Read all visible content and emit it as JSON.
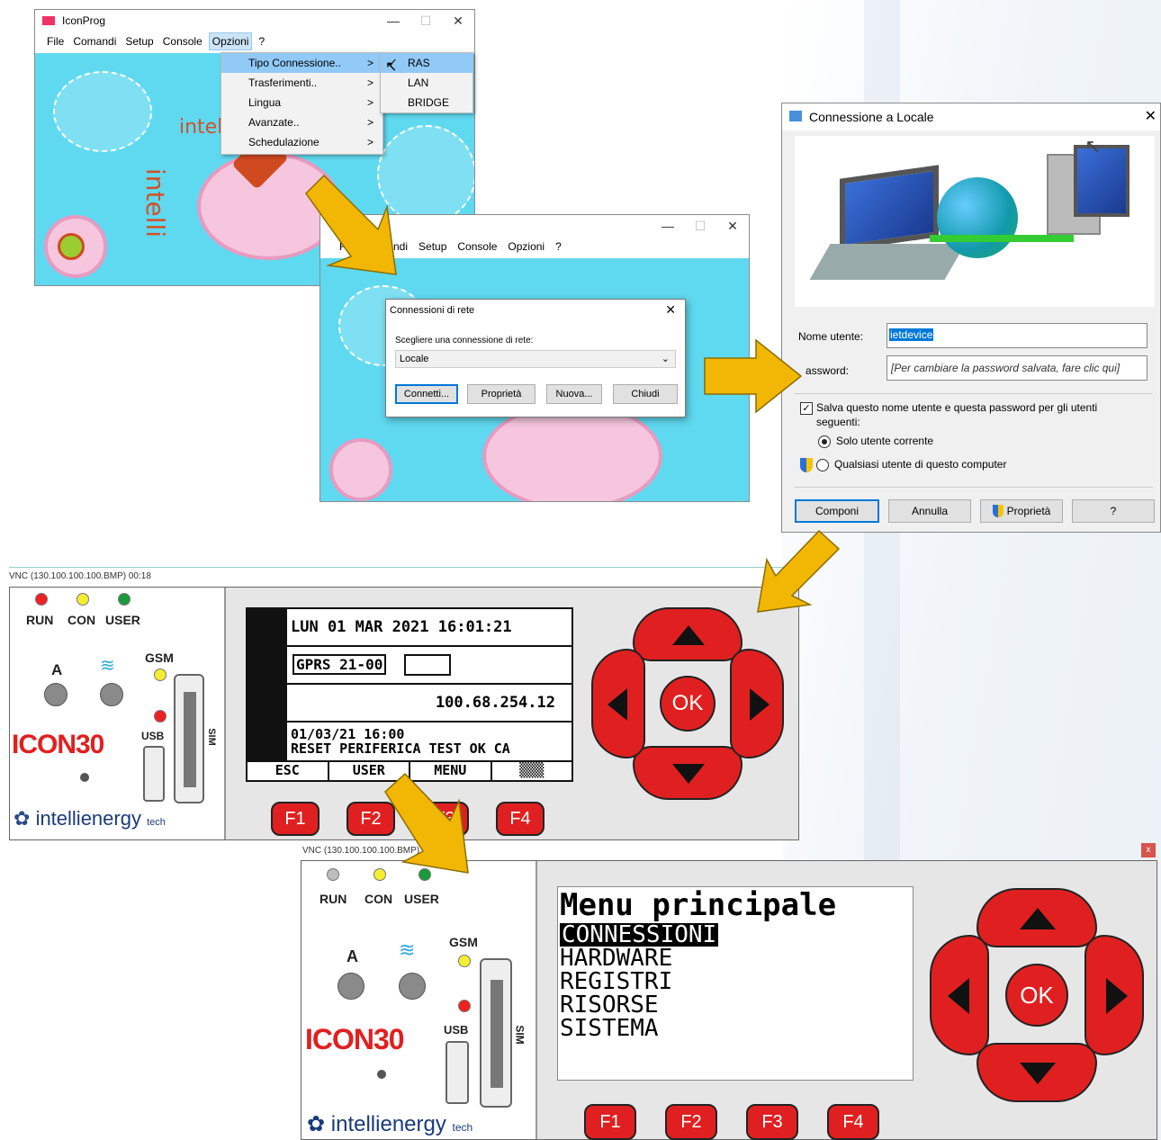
{
  "iconprog": {
    "title": "IconProg",
    "menu": [
      "File",
      "Comandi",
      "Setup",
      "Console",
      "Opzioni",
      "?"
    ],
    "options_menu": [
      "Tipo Connessione..",
      "Trasferimenti..",
      "Lingua",
      "Avanzate..",
      "Schedulazione"
    ],
    "submenu": [
      "RAS",
      "LAN",
      "BRIDGE"
    ],
    "bg_word": "intelli"
  },
  "iconprog2": {
    "title": "IconProg",
    "menu_partial": [
      "Fi",
      "ndi",
      "Setup",
      "Console",
      "Opzioni",
      "?"
    ]
  },
  "net_dialog": {
    "title": "Connessioni di rete",
    "prompt": "Scegliere una connessione di rete:",
    "selected": "Locale",
    "buttons": [
      "Connetti...",
      "Proprietà",
      "Nuova...",
      "Chiudi"
    ]
  },
  "connect_dialog": {
    "title": "Connessione a Locale",
    "user_label": "Nome utente:",
    "user_value": "ietdevice",
    "password_label": "assword:",
    "password_placeholder": "[Per cambiare la password salvata, fare clic qui]",
    "save_line1": "Salva questo nome utente e questa password per gli utenti",
    "save_line2": "seguenti:",
    "radio1": "Solo utente corrente",
    "radio2": "Qualsiasi utente di questo computer",
    "buttons": [
      "Componi",
      "Annulla",
      "Proprietà",
      "?"
    ]
  },
  "vnc1": {
    "title": "VNC (130.100.100.100.BMP) 00:18",
    "leds": [
      "RUN",
      "CON",
      "USER"
    ],
    "gsm": "GSM",
    "a": "A",
    "usb": "USB",
    "sim": "SIM",
    "brand": "ICON30",
    "company": "intellienergy",
    "company_sub": "tech",
    "lcd": {
      "row1": "LUN 01 MAR 2021 16:01:21",
      "row2": "GPRS 21-00",
      "row3": "100.68.254.12",
      "row4a": "01/03/21 16:00",
      "row4b": "RESET PERIFERICA TEST OK CA",
      "softkeys": [
        "ESC",
        "USER",
        "MENU",
        "▒▒▒"
      ]
    },
    "nav_ok": "OK",
    "fkeys": [
      "F1",
      "F2",
      "F3",
      "F4"
    ]
  },
  "vnc2": {
    "title": "VNC (130.100.100.100.BMP) 0",
    "close": "x",
    "leds": [
      "RUN",
      "CON",
      "USER"
    ],
    "gsm": "GSM",
    "a": "A",
    "usb": "USB",
    "sim": "SIM",
    "brand": "ICON30",
    "company": "intellienergy",
    "company_sub": "tech",
    "menu_title": "Menu principale",
    "menu_items": [
      "CONNESSIONI",
      "HARDWARE",
      "REGISTRI",
      "RISORSE",
      "SISTEMA"
    ],
    "nav_ok": "OK",
    "fkeys": [
      "F1",
      "F2",
      "F3",
      "F4"
    ]
  },
  "colors": {
    "arrow": "#f2b705",
    "red": "#e02020",
    "cyan": "#5fd9f0",
    "select": "#0078d7"
  }
}
